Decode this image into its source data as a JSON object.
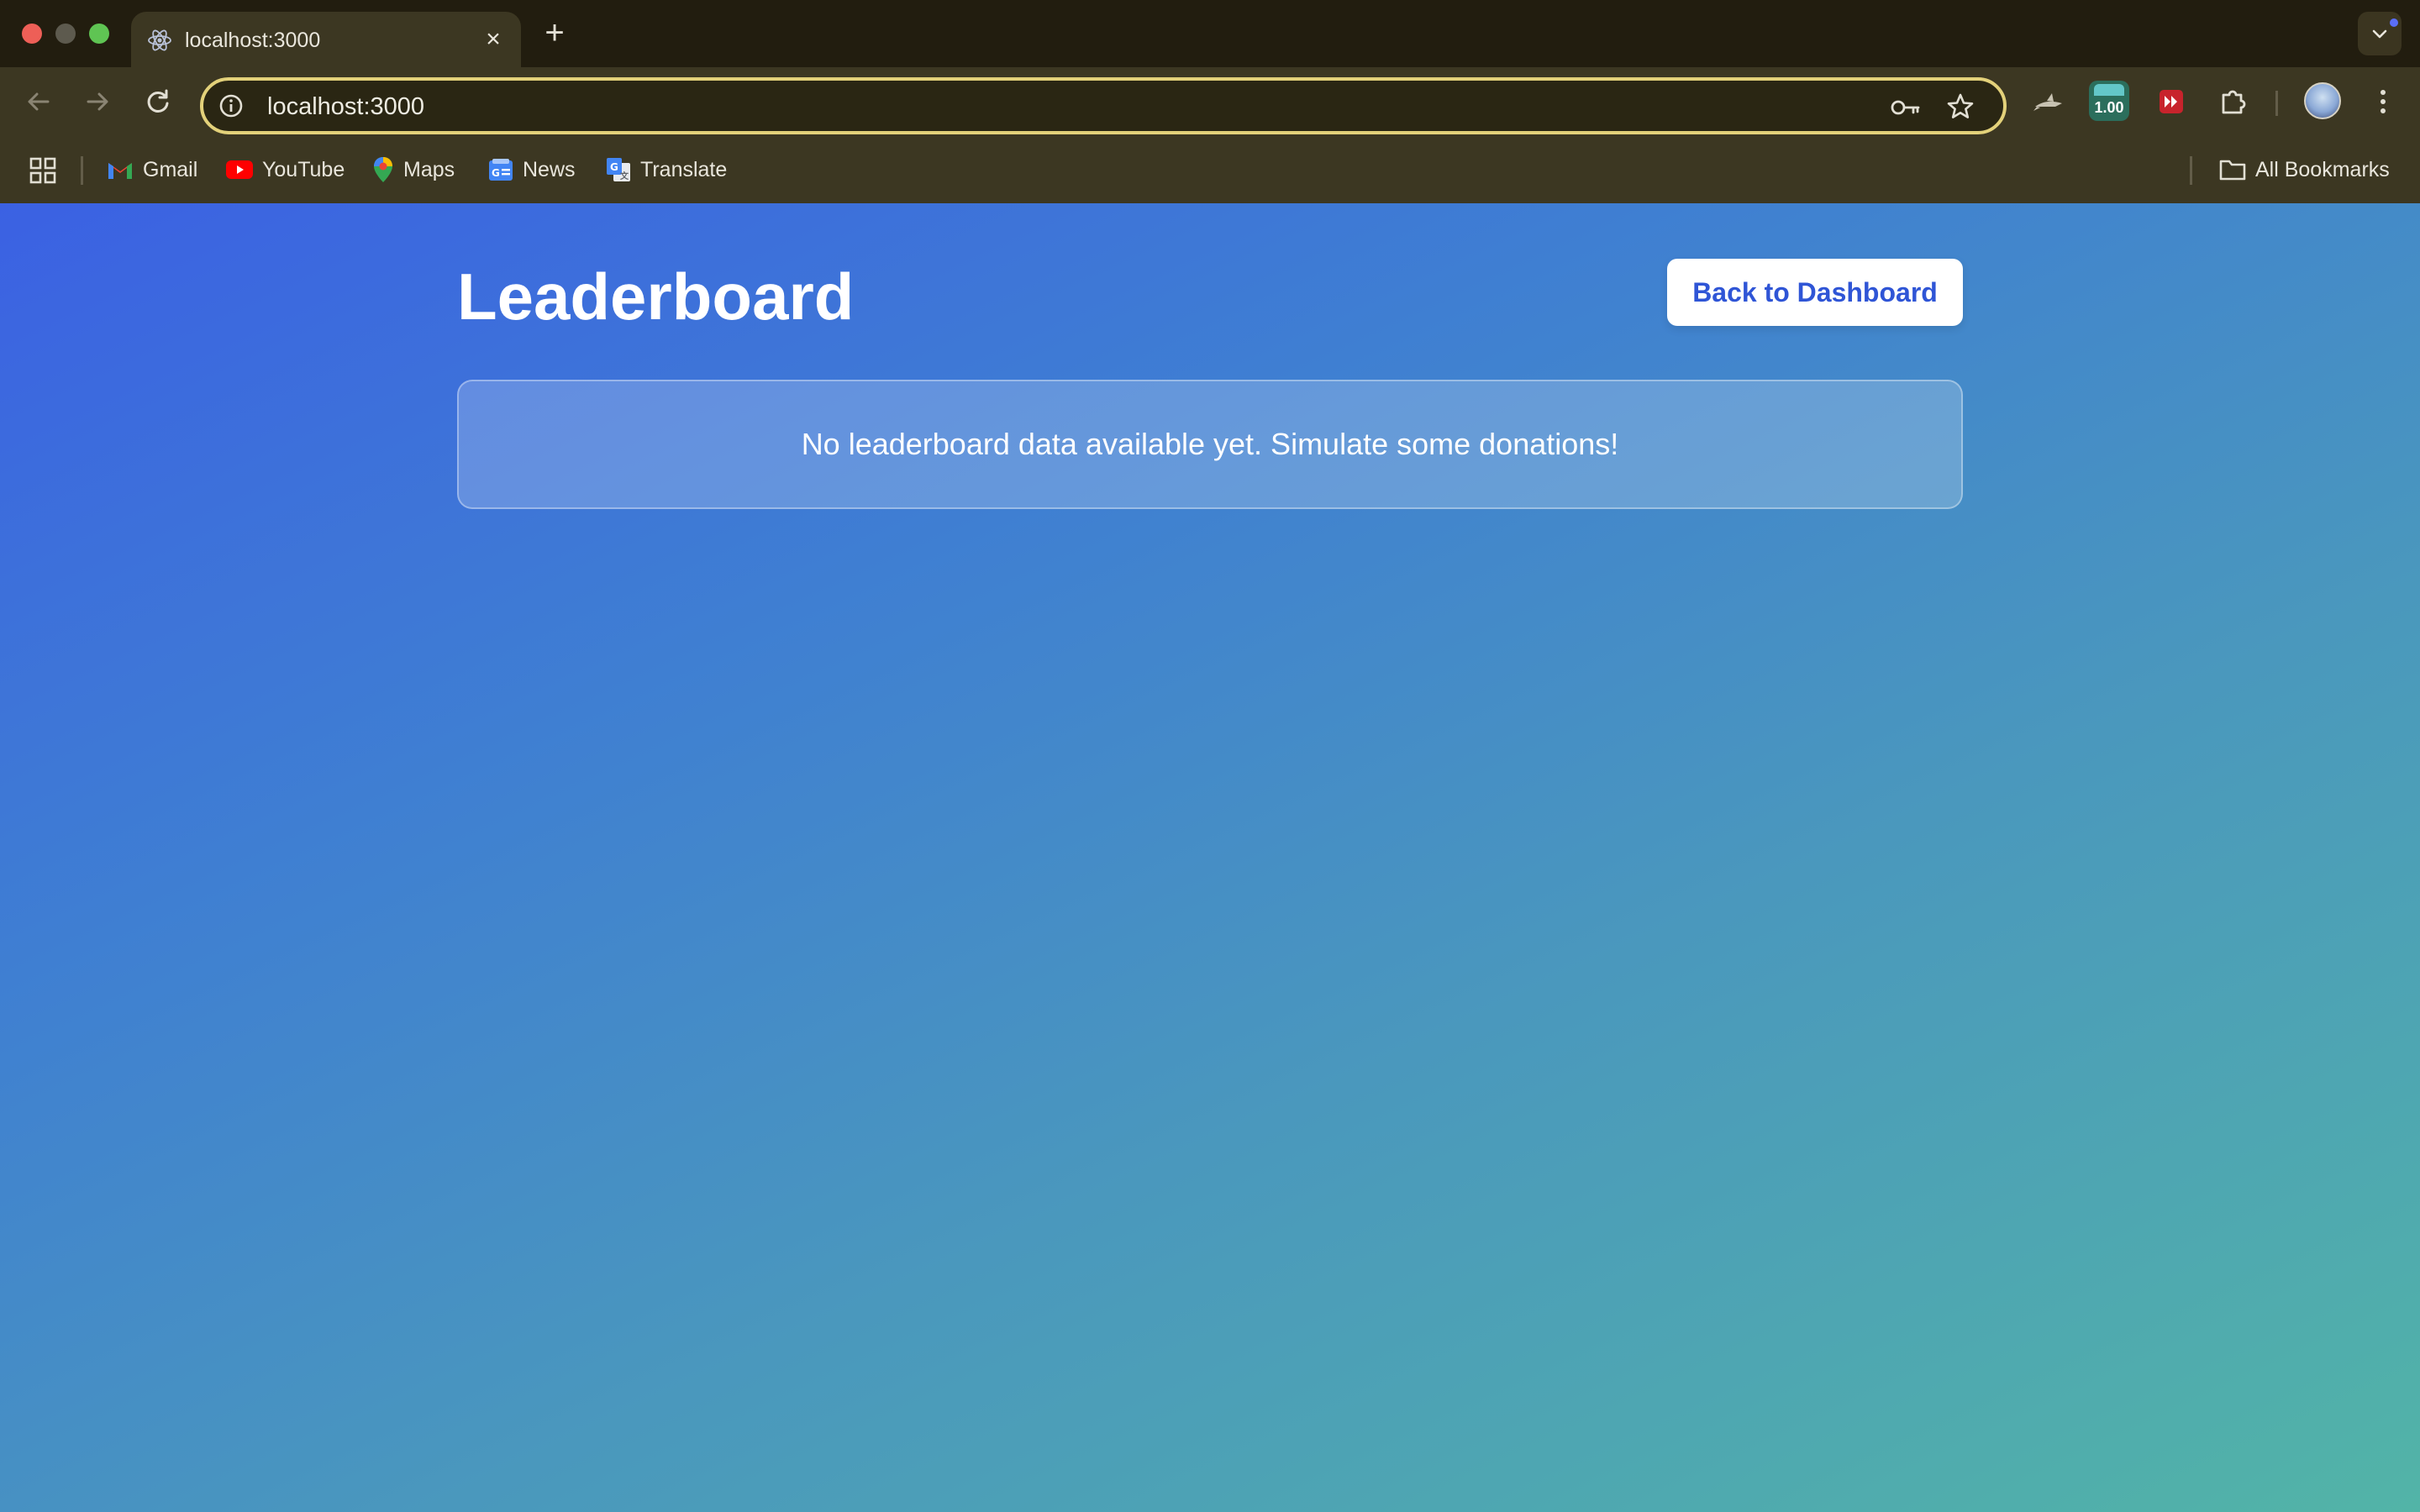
{
  "browser": {
    "tab": {
      "title": "localhost:3000",
      "favicon": "react-icon"
    },
    "address_bar": {
      "url": "localhost:3000"
    },
    "extension_badge": "1.00",
    "bookmarks": [
      {
        "label": "Gmail",
        "icon": "gmail-icon"
      },
      {
        "label": "YouTube",
        "icon": "youtube-icon"
      },
      {
        "label": "Maps",
        "icon": "maps-icon"
      },
      {
        "label": "News",
        "icon": "news-icon"
      },
      {
        "label": "Translate",
        "icon": "translate-icon"
      }
    ],
    "all_bookmarks": "All Bookmarks"
  },
  "page": {
    "title": "Leaderboard",
    "back_button": "Back to Dashboard",
    "empty_message": "No leaderboard data available yet. Simulate some donations!"
  },
  "colors": {
    "gradient_start": "#3b61e3",
    "gradient_end": "#52b4a7",
    "button_text": "#2f55d6"
  }
}
